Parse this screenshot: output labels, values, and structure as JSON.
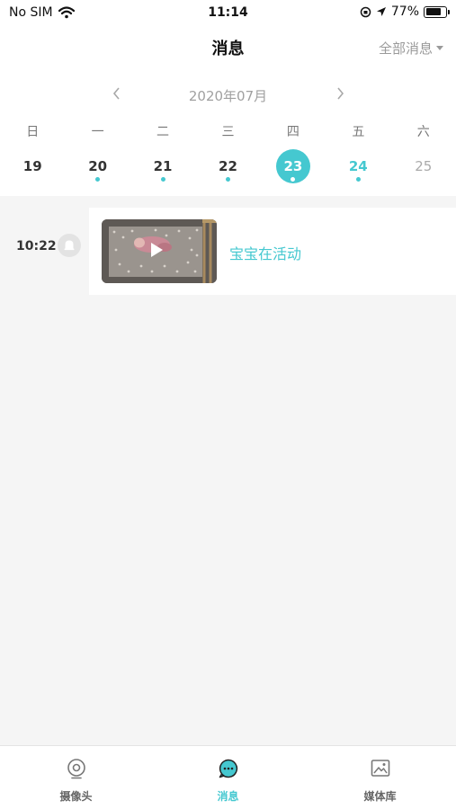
{
  "status_bar": {
    "carrier": "No SIM",
    "time": "11:14",
    "battery_pct": "77%"
  },
  "header": {
    "title": "消息",
    "filter_label": "全部消息"
  },
  "calendar": {
    "month_label": "2020年07月",
    "weekdays": [
      "日",
      "一",
      "二",
      "三",
      "四",
      "五",
      "六"
    ],
    "days": [
      {
        "num": "19",
        "has_events": false,
        "state": "normal"
      },
      {
        "num": "20",
        "has_events": true,
        "state": "normal"
      },
      {
        "num": "21",
        "has_events": true,
        "state": "normal"
      },
      {
        "num": "22",
        "has_events": true,
        "state": "normal"
      },
      {
        "num": "23",
        "has_events": true,
        "state": "selected"
      },
      {
        "num": "24",
        "has_events": true,
        "state": "future"
      },
      {
        "num": "25",
        "has_events": false,
        "state": "disabled"
      }
    ]
  },
  "events": [
    {
      "time": "10:22",
      "title": "宝宝在活动",
      "icon": "bell-icon"
    }
  ],
  "tabbar": {
    "tabs": [
      {
        "label": "摄像头",
        "icon": "camera-icon",
        "active": false
      },
      {
        "label": "消息",
        "icon": "message-icon",
        "active": true
      },
      {
        "label": "媒体库",
        "icon": "gallery-icon",
        "active": false
      }
    ]
  },
  "colors": {
    "accent": "#45c8d0",
    "background": "#f5f5f5"
  }
}
